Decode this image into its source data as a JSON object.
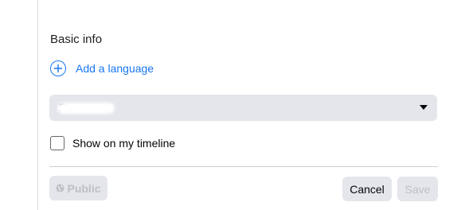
{
  "section": {
    "title": "Basic info"
  },
  "add_language": {
    "label": "Add a language",
    "icon": "plus-circle-icon"
  },
  "language_select": {
    "value": "F",
    "icon": "caret-down-icon"
  },
  "timeline_checkbox": {
    "label": "Show on my timeline",
    "checked": false
  },
  "footer": {
    "privacy_label": "Public",
    "privacy_icon": "globe-icon",
    "cancel_label": "Cancel",
    "save_label": "Save"
  },
  "colors": {
    "accent": "#1877f2",
    "button_bg": "#e4e6eb",
    "disabled_text": "#bcc0c4"
  }
}
